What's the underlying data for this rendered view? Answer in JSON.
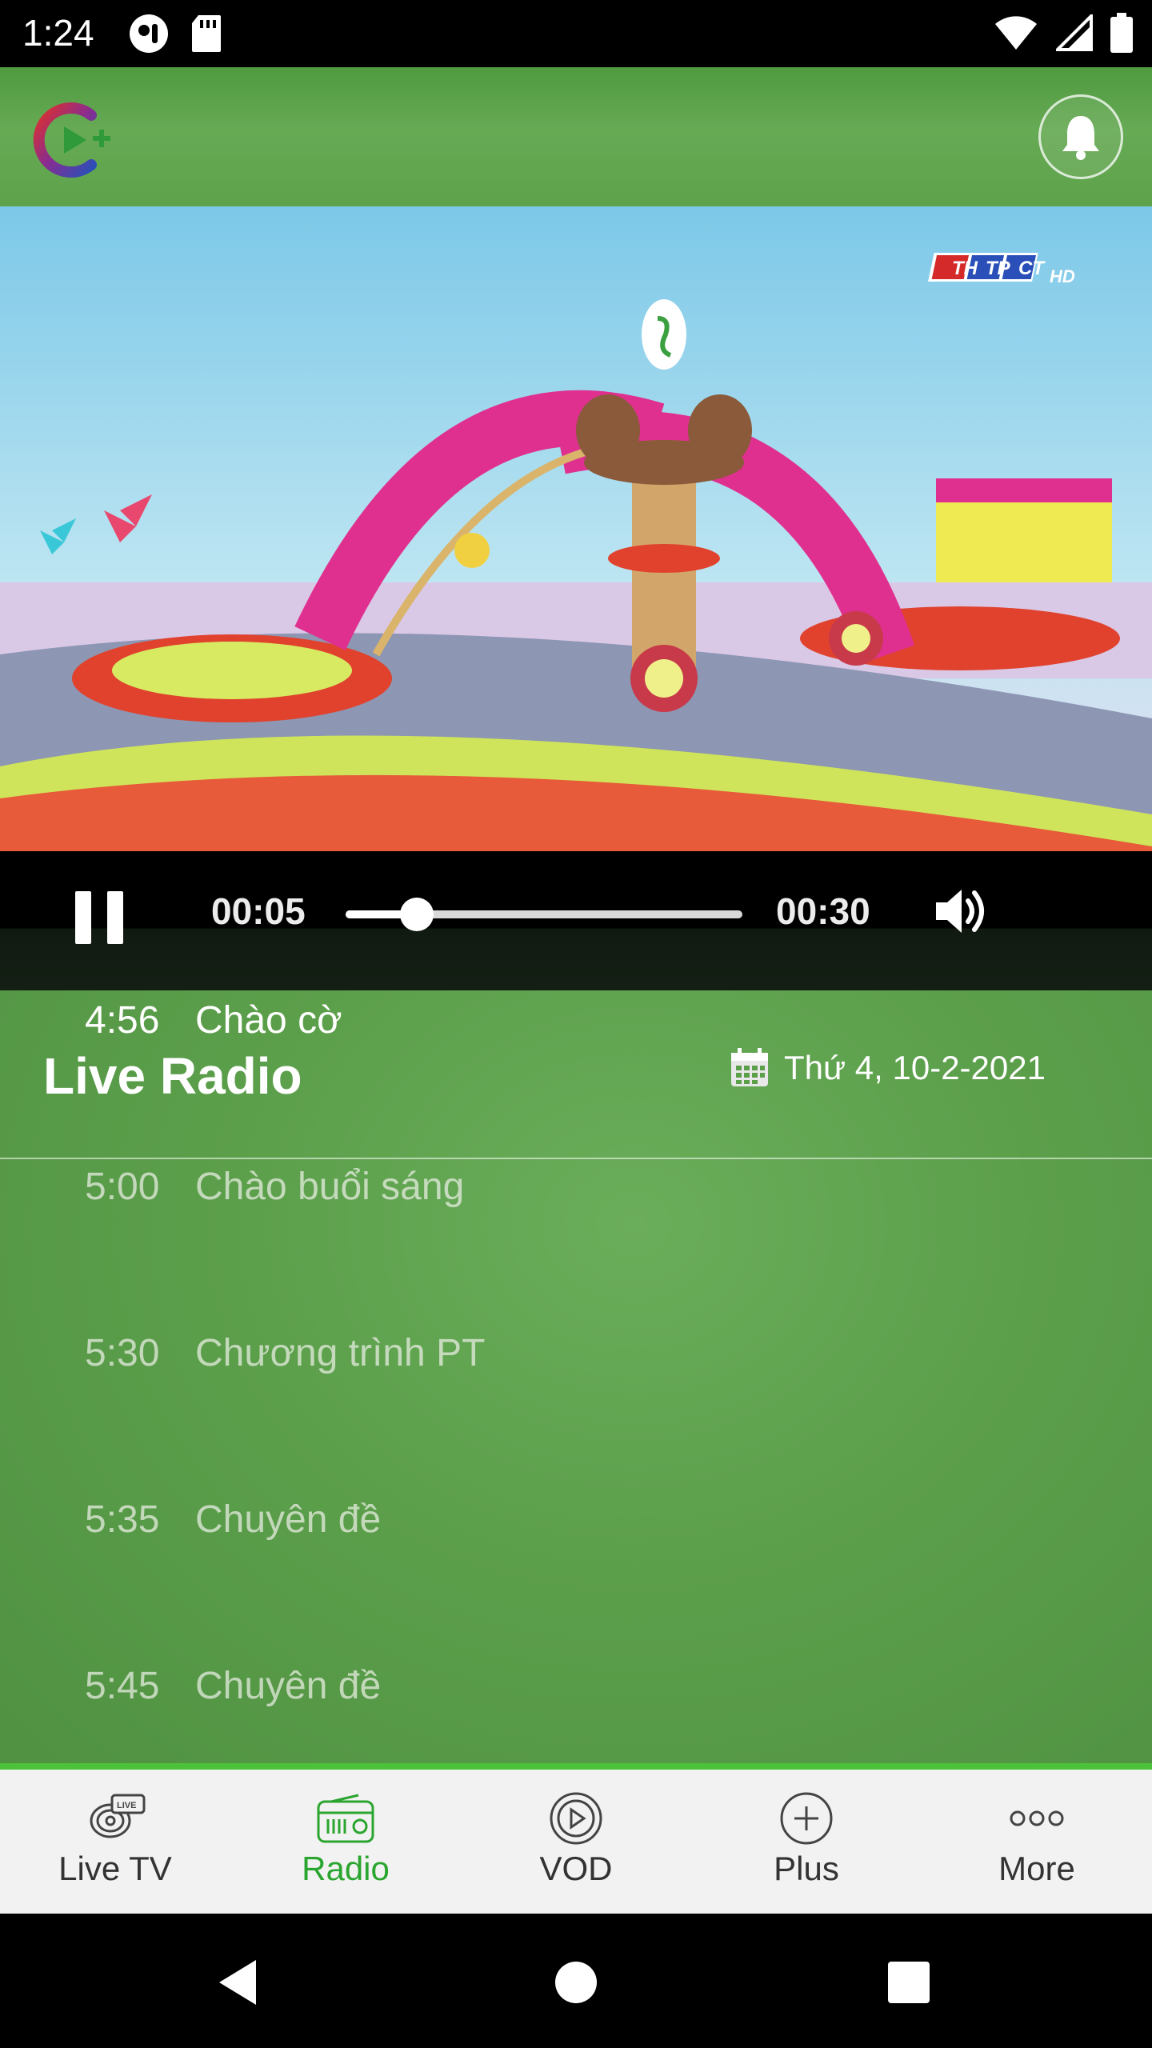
{
  "status_bar": {
    "time": "1:24"
  },
  "header": {
    "logo_name": "app-logo",
    "bell_icon": "bell-icon"
  },
  "video": {
    "channel_logo": "THTPCT HD"
  },
  "player": {
    "current_time": "00:05",
    "total_time": "00:30",
    "progress_fraction": 0.18
  },
  "section": {
    "title": "Live Radio",
    "date": "Thứ 4, 10-2-2021"
  },
  "schedule": [
    {
      "time": "4:56",
      "title": "Chào cờ",
      "current": true
    },
    {
      "time": "5:00",
      "title": "Chào buổi sáng",
      "current": false
    },
    {
      "time": "5:30",
      "title": "Chương trình PT",
      "current": false
    },
    {
      "time": "5:35",
      "title": "Chuyên đề",
      "current": false
    },
    {
      "time": "5:45",
      "title": "Chuyên đề",
      "current": false
    }
  ],
  "bottom_nav": [
    {
      "label": "Live TV",
      "icon": "live-tv-icon",
      "active": false
    },
    {
      "label": "Radio",
      "icon": "radio-icon",
      "active": true
    },
    {
      "label": "VOD",
      "icon": "play-circle-icon",
      "active": false
    },
    {
      "label": "Plus",
      "icon": "plus-circle-icon",
      "active": false
    },
    {
      "label": "More",
      "icon": "more-icon",
      "active": false
    }
  ],
  "colors": {
    "accent": "#2aa52f",
    "header_green": "#5ea24b"
  }
}
